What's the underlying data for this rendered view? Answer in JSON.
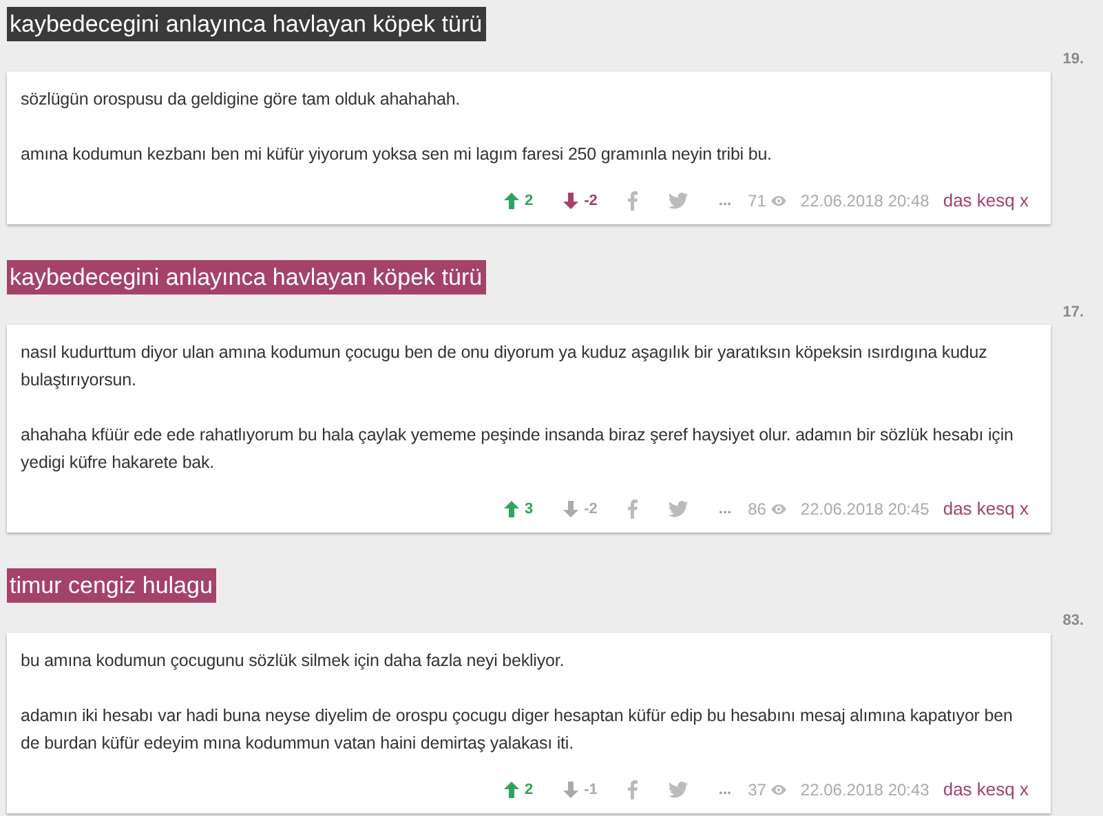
{
  "entries": [
    {
      "title": "kaybedecegini anlayınca havlayan köpek türü",
      "title_selected": true,
      "number": "19.",
      "paragraphs": [
        "sözlügün orospusu da geldigine göre tam olduk ahahahah.",
        "amına kodumun kezbanı ben mi küfür yiyorum yoksa sen mi lagım faresi 250 gramınla neyin tribi bu."
      ],
      "upvotes": "2",
      "upvoted": true,
      "downvotes": "-2",
      "downvoted": true,
      "more": "...",
      "views": "71",
      "date": "22.06.2018 20:48",
      "author": "das kesq x"
    },
    {
      "title": "kaybedecegini anlayınca havlayan köpek türü",
      "title_selected": false,
      "number": "17.",
      "paragraphs": [
        "nasıl kudurttum diyor ulan amına kodumun çocugu ben de onu diyorum ya kuduz aşagılık bir yaratıksın köpeksin ısırdıgına kuduz bulaştırıyorsun.",
        "ahahaha kfüür ede ede rahatlıyorum bu hala çaylak yememe peşinde insanda biraz şeref haysiyet olur. adamın bir sözlük hesabı için yedigi küfre hakarete bak."
      ],
      "upvotes": "3",
      "upvoted": true,
      "downvotes": "-2",
      "downvoted": false,
      "more": "...",
      "views": "86",
      "date": "22.06.2018 20:45",
      "author": "das kesq x"
    },
    {
      "title": "timur cengiz hulagu",
      "title_selected": false,
      "number": "83.",
      "paragraphs": [
        "bu amına kodumun çocugunu sözlük silmek için daha fazla neyi bekliyor.",
        "adamın iki hesabı var hadi buna neyse diyelim de orospu çocugu diger hesaptan küfür edip bu hesabını mesaj alımına kapatıyor ben de burdan küfür edeyim mına kodummun vatan haini demirtaş yalakası iti."
      ],
      "upvotes": "2",
      "upvoted": true,
      "downvotes": "-1",
      "downvoted": false,
      "more": "...",
      "views": "37",
      "date": "22.06.2018 20:43",
      "author": "das kesq x"
    }
  ]
}
